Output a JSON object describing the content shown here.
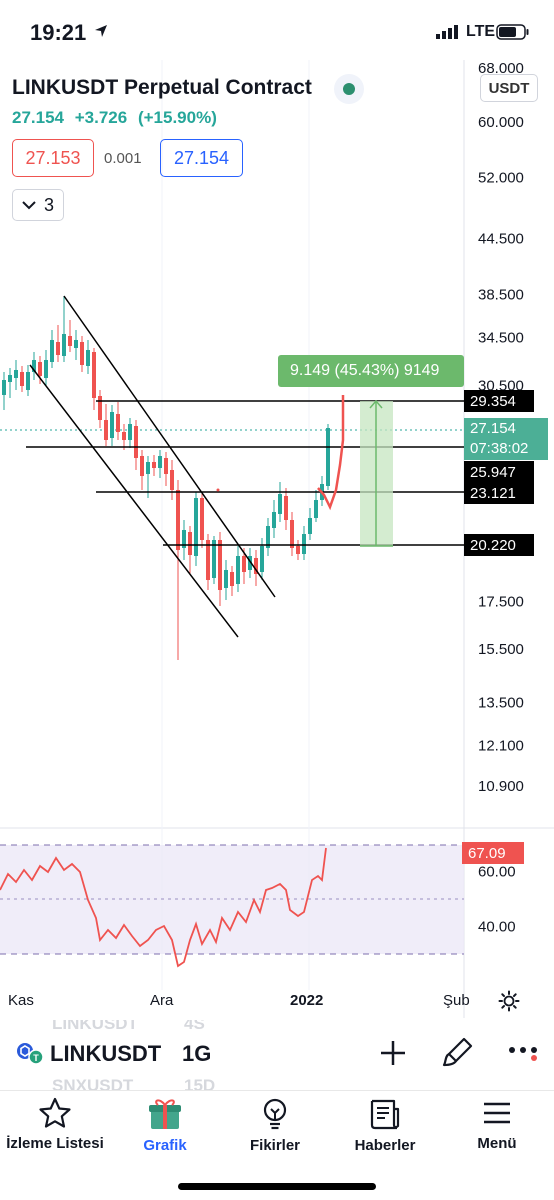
{
  "status_bar": {
    "time": "19:21",
    "network": "LTE"
  },
  "header": {
    "title": "LINKUSDT Perpetual Contract",
    "last_price": "27.154",
    "change": "+3.726",
    "change_pct": "(+15.90%)",
    "bid": "27.153",
    "spread": "0.001",
    "ask": "27.154",
    "studies_count": "3",
    "currency": "USDT"
  },
  "price_axis": {
    "top_partial": "68.000",
    "ticks": [
      "60.000",
      "52.000",
      "44.500",
      "38.500",
      "34.500",
      "30.500",
      "17.500",
      "15.500",
      "13.500",
      "12.100",
      "10.900"
    ]
  },
  "price_tags": {
    "level_1": "29.354",
    "current_price": "27.154",
    "countdown": "07:38:02",
    "level_2": "25.947",
    "level_3": "23.121",
    "level_4": "20.220"
  },
  "measure": {
    "label": "9.149 (45.43%) 9149"
  },
  "rsi": {
    "value": "67.09",
    "ticks": [
      "60.00",
      "40.00"
    ]
  },
  "date_axis": [
    "Kas",
    "Ara",
    "2022",
    "Şub"
  ],
  "symbol_row": {
    "symbol": "LINKUSDT",
    "interval": "1G",
    "ghost_above": "LINKUSDT",
    "ghost_above_interval": "4S",
    "ghost_below": "SNXUSDT",
    "ghost_below_interval": "15D"
  },
  "nav": {
    "items": [
      {
        "label": "İzleme Listesi",
        "icon": "star-icon"
      },
      {
        "label": "Grafik",
        "icon": "chart-gift-icon"
      },
      {
        "label": "Fikirler",
        "icon": "lightbulb-icon"
      },
      {
        "label": "Haberler",
        "icon": "newspaper-icon"
      },
      {
        "label": "Menü",
        "icon": "hamburger-icon"
      }
    ],
    "active": "Grafik"
  },
  "colors": {
    "up": "#26a69a",
    "down": "#ef5350",
    "accent": "#2962ff",
    "measure": "#6cb96c"
  },
  "chart_data": {
    "type": "candlestick",
    "symbol": "LINKUSDT",
    "interval": "1G",
    "price_scale": "log",
    "ylim": [
      10.5,
      68.0
    ],
    "x": [
      "Kas",
      "Ara",
      "2022",
      "Şub"
    ],
    "horizontal_levels": [
      29.354,
      25.947,
      23.121,
      20.22
    ],
    "last_price": 27.154,
    "measure_range": {
      "from": 20.22,
      "to": 29.354,
      "change": 9.149,
      "change_pct": 45.43
    },
    "rsi": {
      "current": 67.09,
      "levels": [
        60,
        40
      ]
    }
  }
}
